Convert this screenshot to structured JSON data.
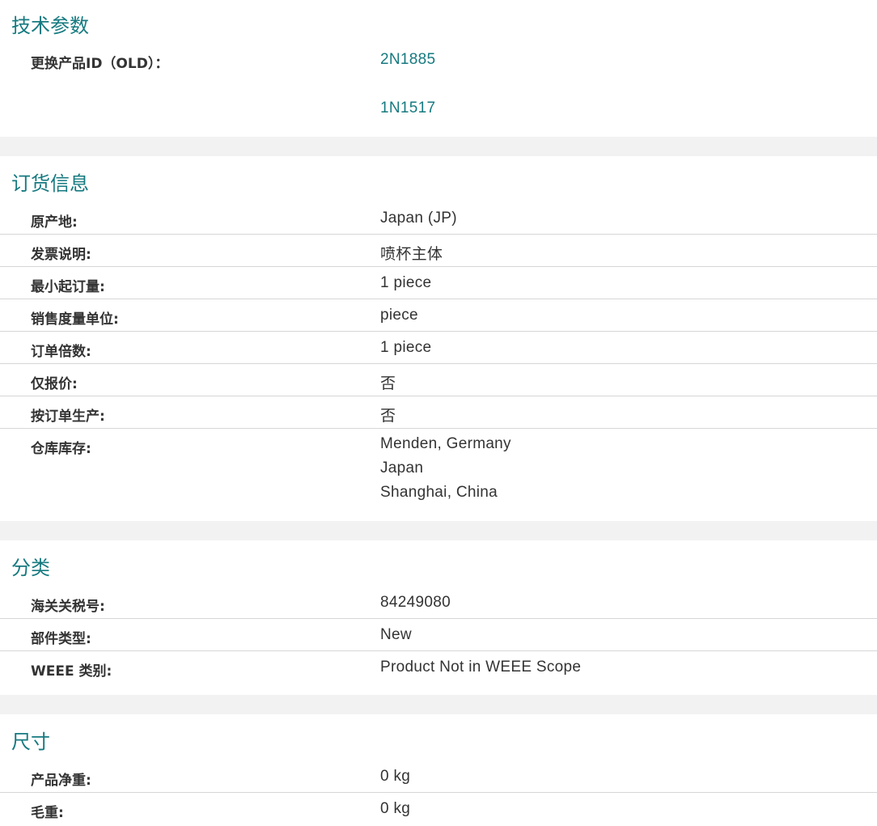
{
  "tech": {
    "title": "技术参数",
    "replacement_label": "更换产品ID（OLD）：",
    "replacement_ids": [
      "2N1885",
      "1N1517"
    ]
  },
  "order": {
    "title": "订货信息",
    "rows": [
      {
        "label": "原产地:",
        "value": "Japan (JP)"
      },
      {
        "label": "发票说明:",
        "value": "喷杯主体"
      },
      {
        "label": "最小起订量:",
        "value": "1 piece"
      },
      {
        "label": "销售度量单位:",
        "value": "piece"
      },
      {
        "label": "订单倍数:",
        "value": "1 piece"
      },
      {
        "label": "仅报价:",
        "value": "否"
      },
      {
        "label": "按订单生产:",
        "value": "否"
      }
    ],
    "stock_label": "仓库库存:",
    "stock_locations": [
      "Menden, Germany",
      "Japan",
      "Shanghai, China"
    ]
  },
  "classification": {
    "title": "分类",
    "rows": [
      {
        "label": "海关关税号:",
        "value": "84249080"
      },
      {
        "label": "部件类型:",
        "value": "New"
      },
      {
        "label": "WEEE 类别:",
        "value": "Product Not in WEEE Scope"
      }
    ]
  },
  "dimensions": {
    "title": "尺寸",
    "rows": [
      {
        "label": "产品净重:",
        "value": "0 kg"
      },
      {
        "label": "毛重:",
        "value": "0 kg"
      }
    ]
  }
}
